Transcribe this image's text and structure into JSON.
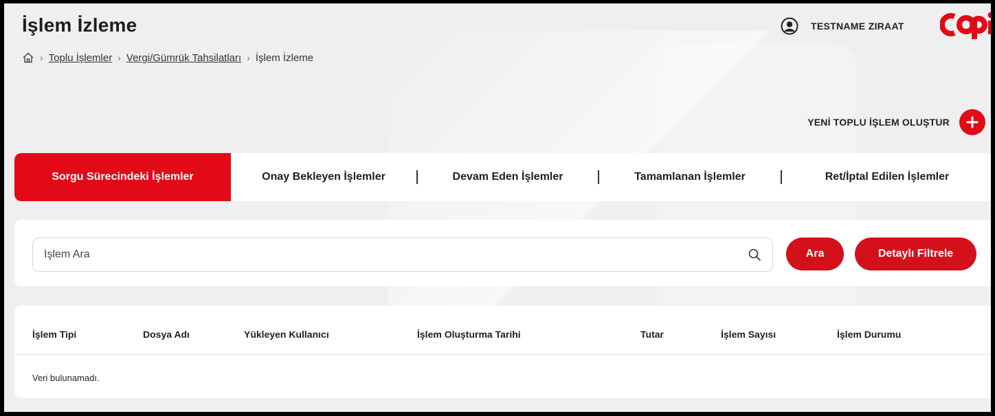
{
  "header": {
    "title": "İşlem İzleme",
    "user_name": "TESTNAME ZIRAAT",
    "logo_text": "COPi"
  },
  "breadcrumb": {
    "items": [
      "Toplu İşlemler",
      "Vergi/Gümrük Tahsilatları"
    ],
    "current": "İşlem İzleme"
  },
  "actions": {
    "new_bulk_label": "YENİ TOPLU İŞLEM OLUŞTUR"
  },
  "tabs": [
    {
      "label": "Sorgu Sürecindeki İşlemler",
      "active": true
    },
    {
      "label": "Onay Bekleyen İşlemler",
      "active": false
    },
    {
      "label": "Devam Eden İşlemler",
      "active": false
    },
    {
      "label": "Tamamlanan İşlemler",
      "active": false
    },
    {
      "label": "Ret/İptal Edilen İşlemler",
      "active": false
    }
  ],
  "search": {
    "placeholder": "İşlem Ara",
    "search_button": "Ara",
    "filter_button": "Detaylı Filtrele"
  },
  "table": {
    "columns": [
      "İşlem Tipi",
      "Dosya Adı",
      "Yükleyen Kullanıcı",
      "İşlem Oluşturma Tarihi",
      "Tutar",
      "İşlem Sayısı",
      "İşlem Durumu"
    ],
    "empty_text": "Veri bulunamadı."
  },
  "colors": {
    "accent": "#e30a17",
    "background": "#efefef"
  }
}
